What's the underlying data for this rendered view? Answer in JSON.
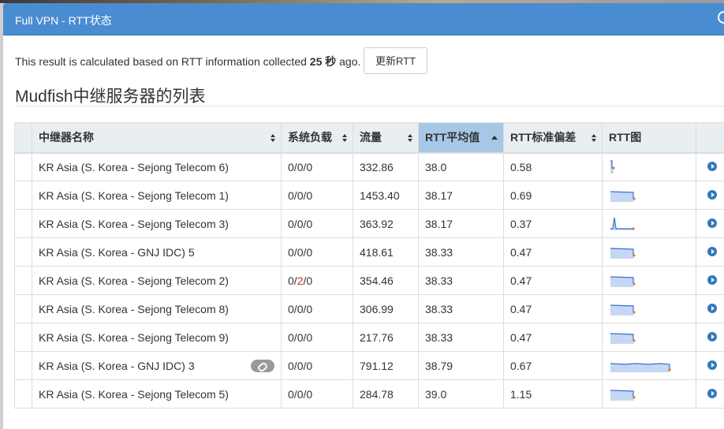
{
  "window": {
    "title": "Full VPN - RTT状态"
  },
  "info": {
    "prefix": "This result is calculated based on RTT information collected ",
    "seconds": "25 秒",
    "suffix": " ago."
  },
  "refresh_label": "更新RTT",
  "section_title": "Mudfish中继服务器的列表",
  "columns": [
    "中继器名称",
    "系统负载",
    "流量",
    "RTT平均值",
    "RTT标准偏差",
    "RTT图"
  ],
  "sorted_column": "RTT平均值",
  "rows": [
    {
      "name": "KR Asia (S. Korea - Sejong Telecom 6)",
      "load": [
        "0",
        "0",
        "0"
      ],
      "traffic": "332.86",
      "rtt_avg": "38.0",
      "rtt_std": "0.58",
      "spark": "narrow",
      "link": false
    },
    {
      "name": "KR Asia (S. Korea - Sejong Telecom 1)",
      "load": [
        "0",
        "0",
        "0"
      ],
      "traffic": "1453.40",
      "rtt_avg": "38.17",
      "rtt_std": "0.69",
      "spark": "block",
      "link": false
    },
    {
      "name": "KR Asia (S. Korea - Sejong Telecom 3)",
      "load": [
        "0",
        "0",
        "0"
      ],
      "traffic": "363.92",
      "rtt_avg": "38.17",
      "rtt_std": "0.37",
      "spark": "spike",
      "link": false
    },
    {
      "name": "KR Asia (S. Korea - GNJ IDC) 5",
      "load": [
        "0",
        "0",
        "0"
      ],
      "traffic": "418.61",
      "rtt_avg": "38.33",
      "rtt_std": "0.47",
      "spark": "block",
      "link": false
    },
    {
      "name": "KR Asia (S. Korea - Sejong Telecom 2)",
      "load": [
        "0",
        "2",
        "0"
      ],
      "traffic": "354.46",
      "rtt_avg": "38.33",
      "rtt_std": "0.47",
      "spark": "block",
      "link": false
    },
    {
      "name": "KR Asia (S. Korea - Sejong Telecom 8)",
      "load": [
        "0",
        "0",
        "0"
      ],
      "traffic": "306.99",
      "rtt_avg": "38.33",
      "rtt_std": "0.47",
      "spark": "block",
      "link": false
    },
    {
      "name": "KR Asia (S. Korea - Sejong Telecom 9)",
      "load": [
        "0",
        "0",
        "0"
      ],
      "traffic": "217.76",
      "rtt_avg": "38.33",
      "rtt_std": "0.47",
      "spark": "block",
      "link": false
    },
    {
      "name": "KR Asia (S. Korea - GNJ IDC) 3",
      "load": [
        "0",
        "0",
        "0"
      ],
      "traffic": "791.12",
      "rtt_avg": "38.79",
      "rtt_std": "0.67",
      "spark": "wide",
      "link": true
    },
    {
      "name": "KR Asia (S. Korea - Sejong Telecom 5)",
      "load": [
        "0",
        "0",
        "0"
      ],
      "traffic": "284.78",
      "rtt_avg": "39.0",
      "rtt_std": "1.15",
      "spark": "block",
      "link": false
    }
  ],
  "colors": {
    "header": "#4a8cd1",
    "sorted_header": "#a6c8e6",
    "spark_line": "#3b6fd1",
    "spark_fill": "#c6d7f5",
    "spark_end": "#e07a2e",
    "load_highlight": "#c9302c",
    "play": "#337ab7"
  }
}
